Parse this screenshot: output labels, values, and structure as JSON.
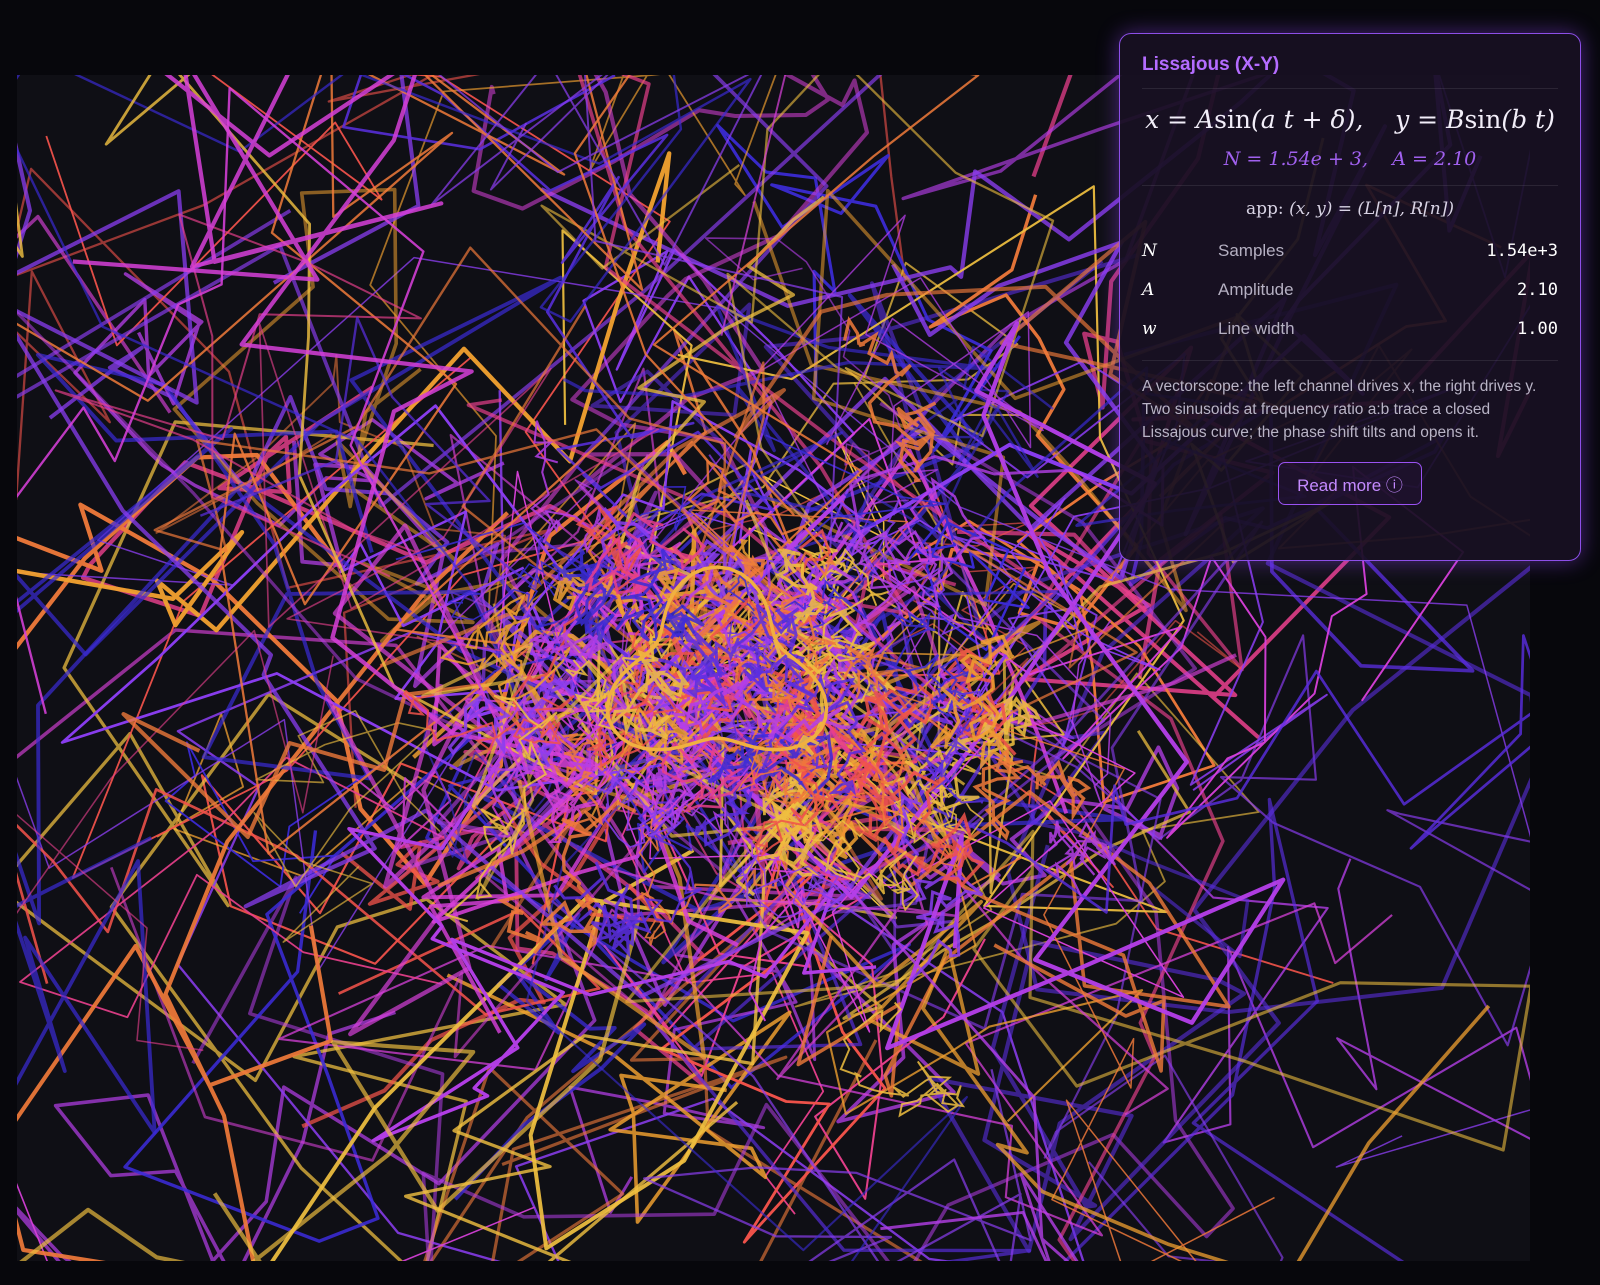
{
  "panel": {
    "title": "Lissajous (X-Y)",
    "formula": {
      "x_lhs": "x",
      "eq": "=",
      "x_amp": "A",
      "fn": "sin",
      "x_arg": "(a t + δ),",
      "y_lhs": "y",
      "y_amp": "B",
      "y_arg": "(b t)"
    },
    "params": {
      "n_part": "N = 1.54e + 3,",
      "a_part": "A = 2.10"
    },
    "app_line": {
      "prefix": "app: ",
      "expr": "(x, y) = (L[n],  R[n])"
    },
    "rows": [
      {
        "symbol": "N",
        "label": "Samples",
        "value": "1.54e+3"
      },
      {
        "symbol": "A",
        "label": "Amplitude",
        "value": "2.10"
      },
      {
        "symbol": "w",
        "label": "Line width",
        "value": "1.00"
      }
    ],
    "description": "A vectorscope: the left channel drives x, the right drives y. Two sinusoids at frequency ratio a:b trace a closed Lissajous curve; the phase shift tilts and opens it.",
    "read_more": "Read more ⓘ"
  },
  "scope": {
    "samples": 1540,
    "amplitude": 2.1,
    "line_width": 1.0,
    "palette": [
      "#3b2bd6",
      "#5a2ee0",
      "#8a3df0",
      "#b43ee8",
      "#d640d8",
      "#e8408c",
      "#f0524a",
      "#f07a3a",
      "#f0a030",
      "#f0c040"
    ]
  }
}
